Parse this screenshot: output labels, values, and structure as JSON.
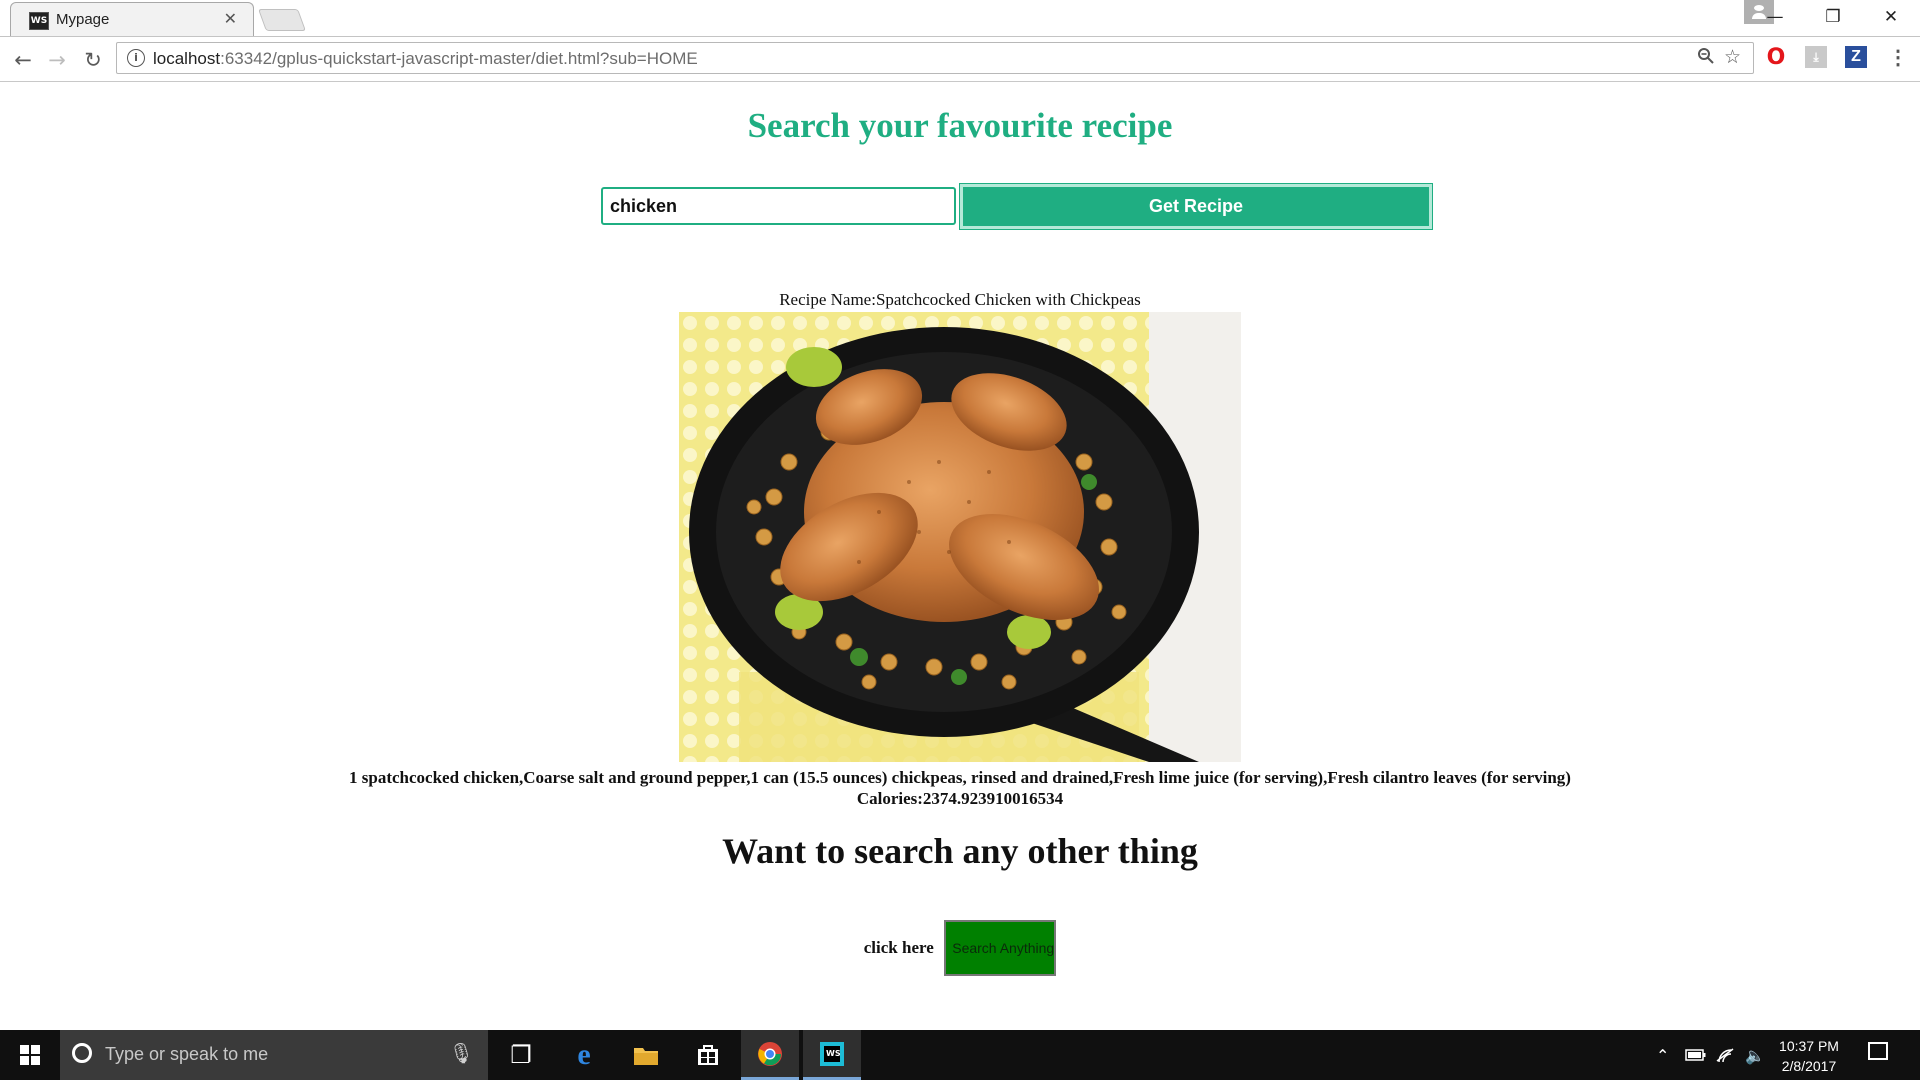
{
  "browser": {
    "tab_title": "Mypage",
    "tab_favicon": "WS",
    "url_host": "localhost",
    "url_rest": ":63342/gplus-quickstart-javascript-master/diet.html?sub=HOME"
  },
  "page": {
    "heading": "Search your favourite recipe",
    "search_value": "chicken",
    "get_recipe_label": "Get Recipe",
    "recipe_name": "Recipe Name:Spatchcocked Chicken with Chickpeas",
    "ingredients": "1 spatchcocked chicken,Coarse salt and ground pepper,1 can (15.5 ounces) chickpeas, rinsed and drained,Fresh lime juice (for serving),Fresh cilantro leaves (for serving)",
    "calories": "Calories:2374.923910016534",
    "other_heading": "Want to search any other thing",
    "click_here": "click here",
    "search_anything_label": "Search Anything"
  },
  "taskbar": {
    "search_placeholder": "Type or speak to me",
    "time": "10:37 PM",
    "date": "2/8/2017"
  },
  "colors": {
    "accent": "#1fae82",
    "search_anything_bg": "#008000"
  }
}
